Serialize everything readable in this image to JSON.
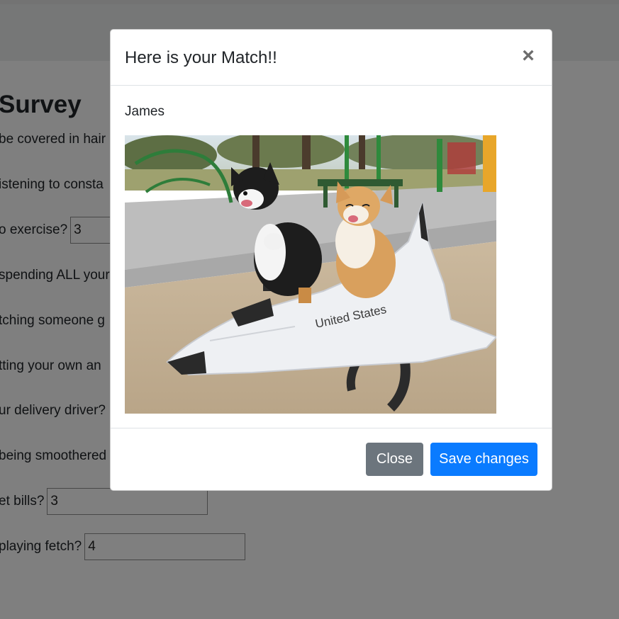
{
  "page": {
    "title": "Survey",
    "questions": [
      {
        "text": "be covered in hair",
        "value": null
      },
      {
        "text": "istening to consta",
        "value": null
      },
      {
        "text": "o exercise?",
        "value": "3"
      },
      {
        "text": "spending ALL your",
        "value": null
      },
      {
        "text": "tching someone g",
        "value": null
      },
      {
        "text": "tting your own an",
        "value": null
      },
      {
        "text": "ur delivery driver?",
        "value": null
      },
      {
        "text": "being smoothered",
        "value": null
      },
      {
        "text": "et bills?",
        "value": "3"
      },
      {
        "text": "playing fetch?",
        "value": "4"
      }
    ]
  },
  "modal": {
    "title": "Here is your Match!!",
    "close_glyph": "×",
    "match_name": "James",
    "photo_text": "United States",
    "buttons": {
      "close": "Close",
      "save": "Save changes"
    }
  },
  "colors": {
    "primary": "#0a7bff",
    "secondary": "#6c757d",
    "backdrop": "rgba(0,0,0,0.5)"
  }
}
